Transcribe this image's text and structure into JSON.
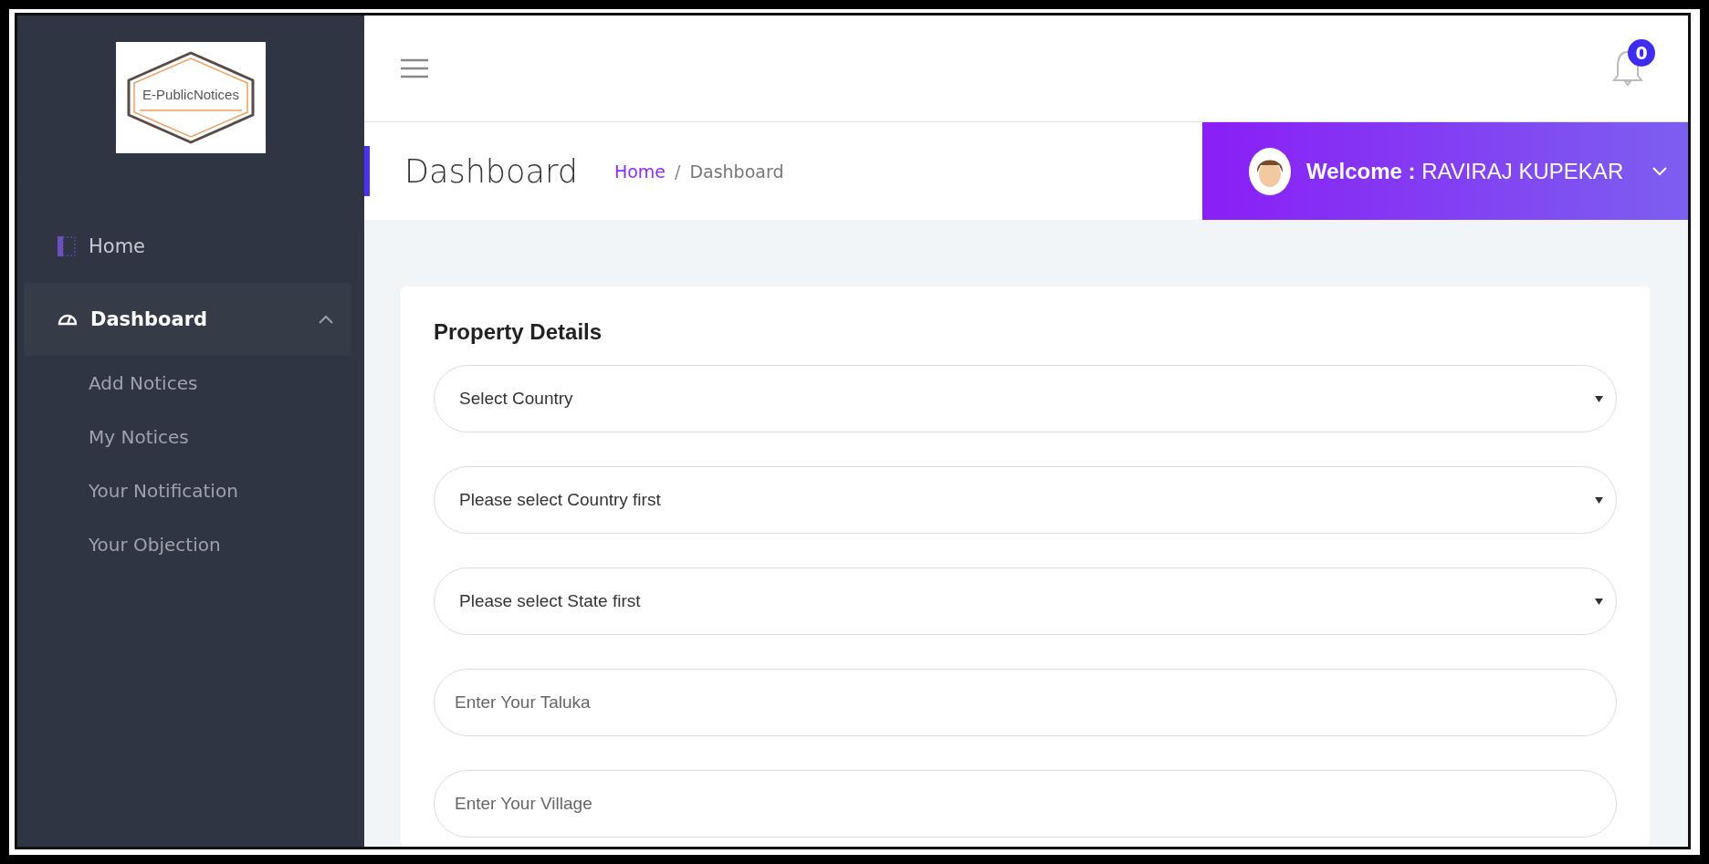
{
  "logo": {
    "text": "E-PublicNotices"
  },
  "sidebar": {
    "items": [
      {
        "label": "Home",
        "kind": "link",
        "selected": false
      },
      {
        "label": "Dashboard",
        "kind": "group",
        "selected": true,
        "expanded": true,
        "children": [
          {
            "label": "Add Notices"
          },
          {
            "label": "My Notices"
          },
          {
            "label": "Your Notification"
          },
          {
            "label": "Your Objection"
          }
        ]
      }
    ]
  },
  "topbar": {
    "notification_count": "0"
  },
  "page_header": {
    "title": "Dashboard",
    "separator": "/",
    "breadcrumb": [
      {
        "label": "Home",
        "kind": "link"
      },
      {
        "label": "Dashboard",
        "kind": "current"
      }
    ]
  },
  "user": {
    "welcome": "Welcome :",
    "name": "RAVIRAJ KUPEKAR"
  },
  "form": {
    "title": "Property Details",
    "fields": [
      {
        "kind": "select",
        "placeholder": "Select Country"
      },
      {
        "kind": "select",
        "placeholder": "Please select Country first"
      },
      {
        "kind": "select",
        "placeholder": "Please select State first"
      },
      {
        "kind": "input",
        "placeholder": "Enter Your Taluka"
      },
      {
        "kind": "input",
        "placeholder": "Enter Your Village"
      }
    ]
  }
}
